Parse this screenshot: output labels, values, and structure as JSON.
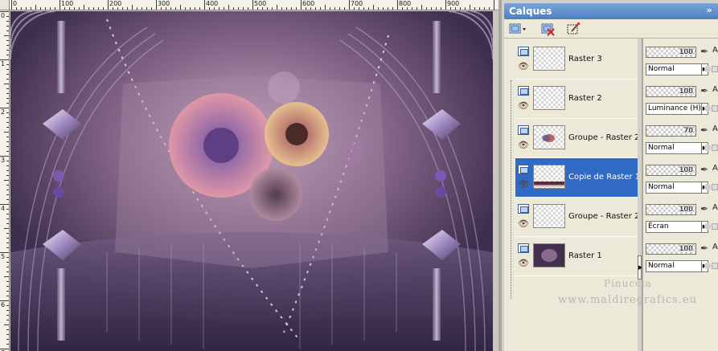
{
  "ruler": {
    "top_labels": [
      "0",
      "100",
      "200",
      "300",
      "400",
      "500",
      "600",
      "700",
      "800",
      "900"
    ],
    "left_labels": [
      "0",
      "1",
      "2",
      "3",
      "4",
      "5",
      "6",
      "7"
    ]
  },
  "panel": {
    "title": "Calques",
    "close_glyph": "»"
  },
  "layers": [
    {
      "name": "Raster 3",
      "opacity": "100",
      "blend": "Normal",
      "selected": false
    },
    {
      "name": "Raster 2",
      "opacity": "100",
      "blend": "Luminance (H)",
      "selected": false
    },
    {
      "name": "Groupe - Raster 2",
      "opacity": "70",
      "blend": "Normal",
      "selected": false
    },
    {
      "name": "Copie de Raster 1",
      "opacity": "100",
      "blend": "Normal",
      "selected": true
    },
    {
      "name": "Groupe - Raster 2",
      "opacity": "100",
      "blend": "Écran",
      "selected": false
    },
    {
      "name": "Raster 1",
      "opacity": "100",
      "blend": "Normal",
      "selected": false
    }
  ],
  "icons": {
    "layer": "layer-icon",
    "eye": "eye-icon",
    "lock": "brush-lock-icon",
    "new_layer": "new-layer-icon",
    "delete_layer": "delete-layer-icon",
    "mask": "mask-icon"
  },
  "props_letter": "A",
  "watermark": {
    "line1": "Pinuccia",
    "line2": "www.maldiregrafics.eu"
  },
  "colors": {
    "selection": "#316ac5",
    "titlebar": "#4d7fc0"
  }
}
